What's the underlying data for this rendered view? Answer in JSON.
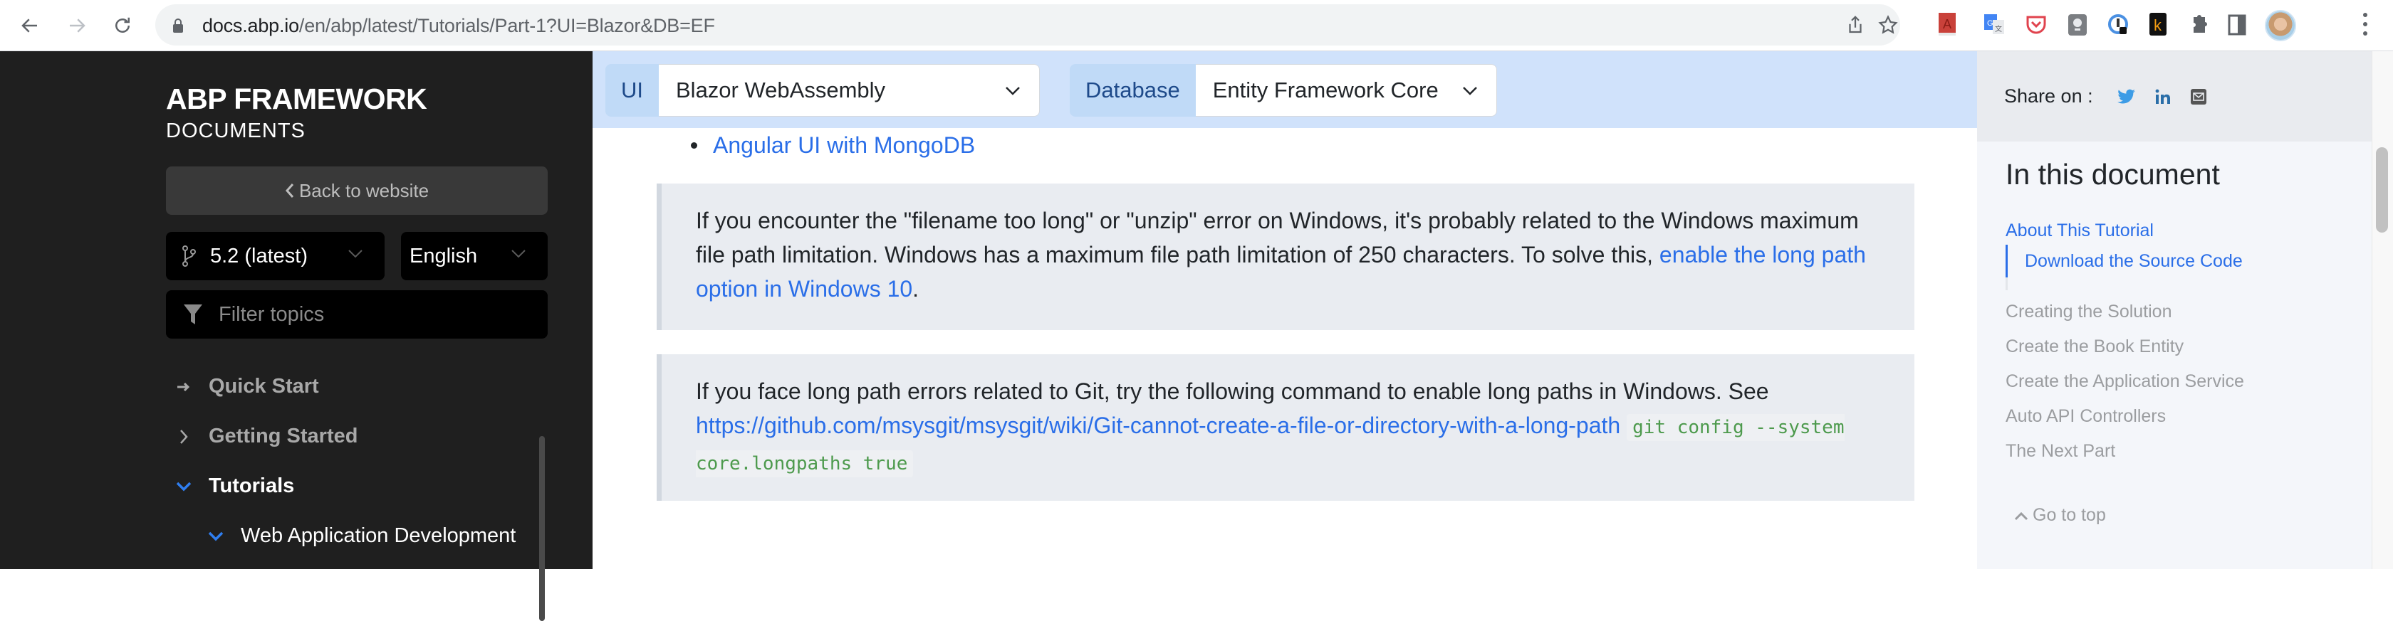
{
  "browser": {
    "url_host": "docs.abp.io",
    "url_path": "/en/abp/latest/Tutorials/Part-1?UI=Blazor&DB=EF",
    "extensions": [
      "dictionary-extension-icon",
      "google-translate-icon",
      "pocket-icon",
      "lightbulb-extension-icon",
      "password-lock-icon",
      "k-extension-icon",
      "puzzle-extensions-icon",
      "side-panel-icon"
    ]
  },
  "sidebar": {
    "brand_title": "ABP FRAMEWORK",
    "brand_subtitle": "DOCUMENTS",
    "back_label": "Back to website",
    "version": "5.2 (latest)",
    "language": "English",
    "filter_placeholder": "Filter topics",
    "tree": [
      {
        "label": "Quick Start",
        "icon": "arrow-right-icon",
        "state": "link"
      },
      {
        "label": "Getting Started",
        "icon": "chevron-right-icon",
        "state": "collapsed"
      },
      {
        "label": "Tutorials",
        "icon": "chevron-down-icon",
        "state": "expanded"
      },
      {
        "label": "Web Application Development",
        "icon": "chevron-down-icon",
        "state": "expanded"
      }
    ]
  },
  "filterbar": {
    "ui_label": "UI",
    "ui_value": "Blazor WebAssembly",
    "db_label": "Database",
    "db_value": "Entity Framework Core"
  },
  "content": {
    "bullet_link": "Angular UI with MongoDB",
    "note1": {
      "text": "If you encounter the \"filename too long\" or \"unzip\" error on Windows, it's probably related to the Windows maximum file path limitation. Windows has a maximum file path limitation of 250 characters. To solve this, ",
      "link": "enable the long path option in Windows 10",
      "suffix": "."
    },
    "note2": {
      "text": "If you face long path errors related to Git, try the following command to enable long paths in Windows. See ",
      "link": "https://github.com/msysgit/msysgit/wiki/Git-cannot-create-a-file-or-directory-with-a-long-path",
      "code": "git config --system core.longpaths true"
    }
  },
  "toc": {
    "share_label": "Share on :",
    "share_icons": [
      "twitter-icon",
      "linkedin-icon",
      "email-icon"
    ],
    "title": "In this document",
    "active": "About This Tutorial",
    "active_sub": "Download the Source Code",
    "items": [
      "Creating the Solution",
      "Create the Book Entity",
      "Create the Application Service",
      "Auto API Controllers",
      "The Next Part"
    ],
    "go_top": "Go to top"
  },
  "colors": {
    "link": "#2a6ee8",
    "sidebar_bg": "#1f1f1f",
    "filterbar_bg": "#d0e2fb",
    "code": "#4d9a4d"
  }
}
